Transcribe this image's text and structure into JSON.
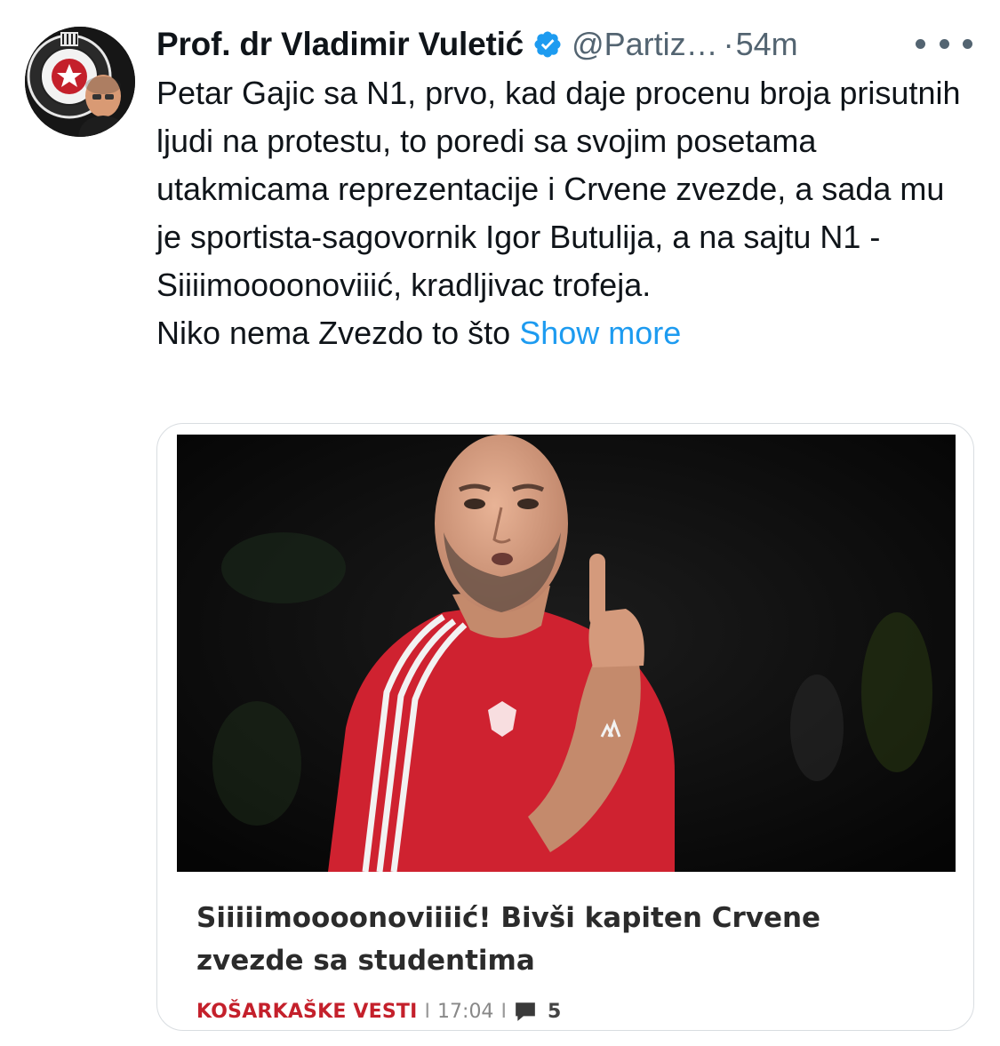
{
  "tweet": {
    "display_name": "Prof. dr Vladimir Vuletić",
    "handle": "@Partiz…",
    "dot": "·",
    "time": "54m",
    "text_lines": [
      "Petar Gajic sa N1, prvo, kad daje procenu broja prisutnih ljudi na protestu, to poredi sa svojim posetama utakmicama reprezentacije i Crvene zvezde, a sada mu je sportista-sagovornik Igor Butulija, a na sajtu N1 - Siiiimoooonoviiić, kradljivac trofeja.",
      "Niko nema Zvezdo to što"
    ],
    "show_more": "Show more"
  },
  "card": {
    "title": "Siiiiimoooonoviiiić! Bivši kapiten Crvene zvezde sa studentima",
    "category": "KOŠARKAŠKE VESTI",
    "separator": "I",
    "time": "17:04",
    "comments": "5"
  },
  "icons": {
    "verified": "verified-badge-icon",
    "more": "more-options-icon",
    "comment": "comment-icon"
  },
  "colors": {
    "link": "#1d9bf0",
    "category": "#c4202b",
    "muted": "#536471",
    "verified": "#1d9bf0"
  }
}
